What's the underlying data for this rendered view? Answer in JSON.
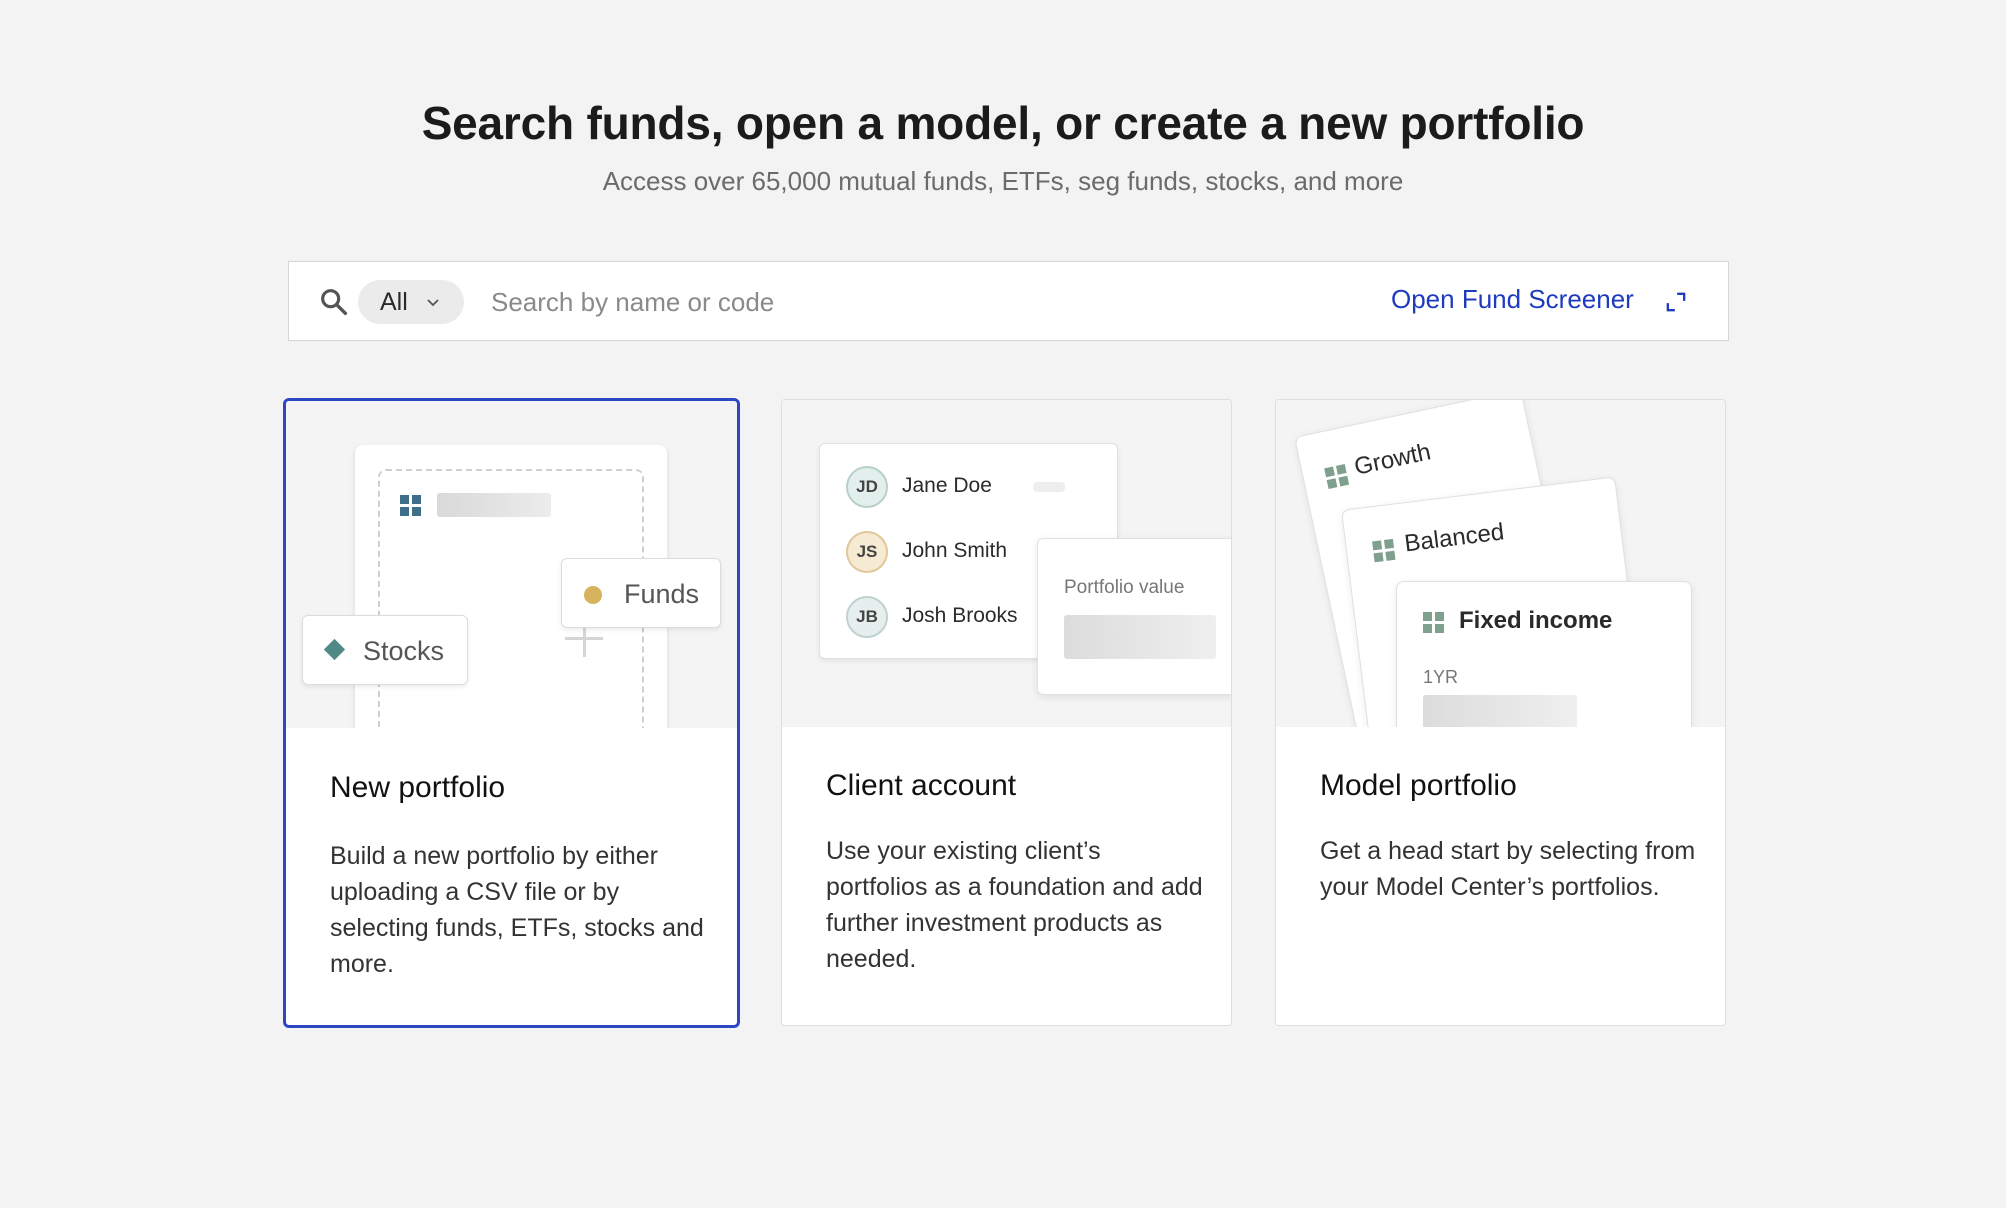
{
  "header": {
    "title": "Search funds, open a model, or create a new portfolio",
    "subtitle": "Access over 65,000 mutual funds, ETFs, seg funds, stocks, and more"
  },
  "search": {
    "filter_label": "All",
    "placeholder": "Search by name or code",
    "value": "",
    "screener_link": "Open Fund Screener",
    "icons": [
      "search-icon",
      "chevron-down-icon",
      "expand-icon"
    ]
  },
  "cards": [
    {
      "title": "New portfolio",
      "description": "Build a new portfolio by either uploading a CSV file or by selecting funds, ETFs, stocks and more.",
      "selected": true,
      "illustration": {
        "chip_funds": "Funds",
        "chip_stocks": "Stocks"
      }
    },
    {
      "title": "Client account",
      "description": "Use your existing client’s portfolios as a foundation and add further investment products as needed.",
      "selected": false,
      "illustration": {
        "clients": [
          {
            "initials": "JD",
            "name": "Jane Doe"
          },
          {
            "initials": "JS",
            "name": "John Smith"
          },
          {
            "initials": "JB",
            "name": "Josh Brooks"
          }
        ],
        "value_label": "Portfolio value"
      }
    },
    {
      "title": "Model portfolio",
      "description": "Get a head start by selecting from your Model Center’s portfolios.",
      "selected": false,
      "illustration": {
        "models": [
          "Growth",
          "Balanced",
          "Fixed income"
        ],
        "period": "1YR"
      }
    }
  ],
  "colors": {
    "accent": "#1e3bc0",
    "selected_border": "#2e46c2",
    "background": "#f3f3f3",
    "funds_dot": "#d6b35c",
    "stocks_diamond": "#4f8a86"
  }
}
